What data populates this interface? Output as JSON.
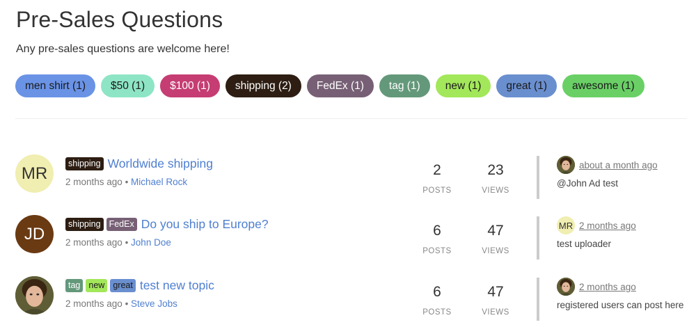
{
  "header": {
    "title": "Pre-Sales Questions",
    "subtitle": "Any pre-sales questions are welcome here!"
  },
  "tag_bar": [
    {
      "label": "men shirt (1)",
      "bg": "#6a93e6",
      "fg": "#1a1a1a"
    },
    {
      "label": "$50 (1)",
      "bg": "#8ee5c6",
      "fg": "#1a1a1a"
    },
    {
      "label": "$100 (1)",
      "bg": "#c53d73",
      "fg": "#ffffff"
    },
    {
      "label": "shipping (2)",
      "bg": "#2d1d12",
      "fg": "#ffffff"
    },
    {
      "label": "FedEx (1)",
      "bg": "#776075",
      "fg": "#ffffff"
    },
    {
      "label": "tag (1)",
      "bg": "#64987a",
      "fg": "#ffffff"
    },
    {
      "label": "new (1)",
      "bg": "#a3e75a",
      "fg": "#1a1a1a"
    },
    {
      "label": "great (1)",
      "bg": "#6a8fcf",
      "fg": "#1a1a1a"
    },
    {
      "label": "awesome (1)",
      "bg": "#6ad066",
      "fg": "#1a1a1a"
    }
  ],
  "topics": [
    {
      "avatar_text": "MR",
      "avatar_bg": "#f0eeb0",
      "avatar_fg": "#333333",
      "tags": [
        {
          "label": "shipping",
          "bg": "#2d1d12",
          "fg": "#ffffff"
        }
      ],
      "title": "Worldwide shipping",
      "time": "2 months ago",
      "separator": "•",
      "author": "Michael Rock",
      "posts": "2",
      "views": "23",
      "posts_label": "POSTS",
      "views_label": "VIEWS",
      "last_time": "about a month ago",
      "last_text": "@John Ad test",
      "last_avatar_text": "",
      "last_avatar_icon": "user-photo-icon",
      "last_avatar_bg": "#6b6a3f"
    },
    {
      "avatar_text": "JD",
      "avatar_bg": "#6a3a12",
      "avatar_fg": "#ffffff",
      "tags": [
        {
          "label": "shipping",
          "bg": "#2d1d12",
          "fg": "#ffffff"
        },
        {
          "label": "FedEx",
          "bg": "#776075",
          "fg": "#ffffff"
        }
      ],
      "title": "Do you ship to Europe?",
      "time": "2 months ago",
      "separator": "•",
      "author": "John Doe",
      "posts": "6",
      "views": "47",
      "posts_label": "POSTS",
      "views_label": "VIEWS",
      "last_time": "2 months ago",
      "last_text": "test uploader",
      "last_avatar_text": "MR",
      "last_avatar_icon": "",
      "last_avatar_bg": "#f0eeb0"
    },
    {
      "avatar_text": "",
      "avatar_icon": "user-photo-icon",
      "avatar_bg": "#6b6a3f",
      "avatar_fg": "#ffffff",
      "tags": [
        {
          "label": "tag",
          "bg": "#64987a",
          "fg": "#ffffff"
        },
        {
          "label": "new",
          "bg": "#a3e75a",
          "fg": "#1a1a1a"
        },
        {
          "label": "great",
          "bg": "#6a8fcf",
          "fg": "#1a1a1a"
        }
      ],
      "title": "test new topic",
      "time": "2 months ago",
      "separator": "•",
      "author": "Steve Jobs",
      "posts": "6",
      "views": "47",
      "posts_label": "POSTS",
      "views_label": "VIEWS",
      "last_time": "2 months ago",
      "last_text": "registered users can post here",
      "last_avatar_text": "",
      "last_avatar_icon": "user-photo-icon",
      "last_avatar_bg": "#6b6a3f"
    }
  ]
}
